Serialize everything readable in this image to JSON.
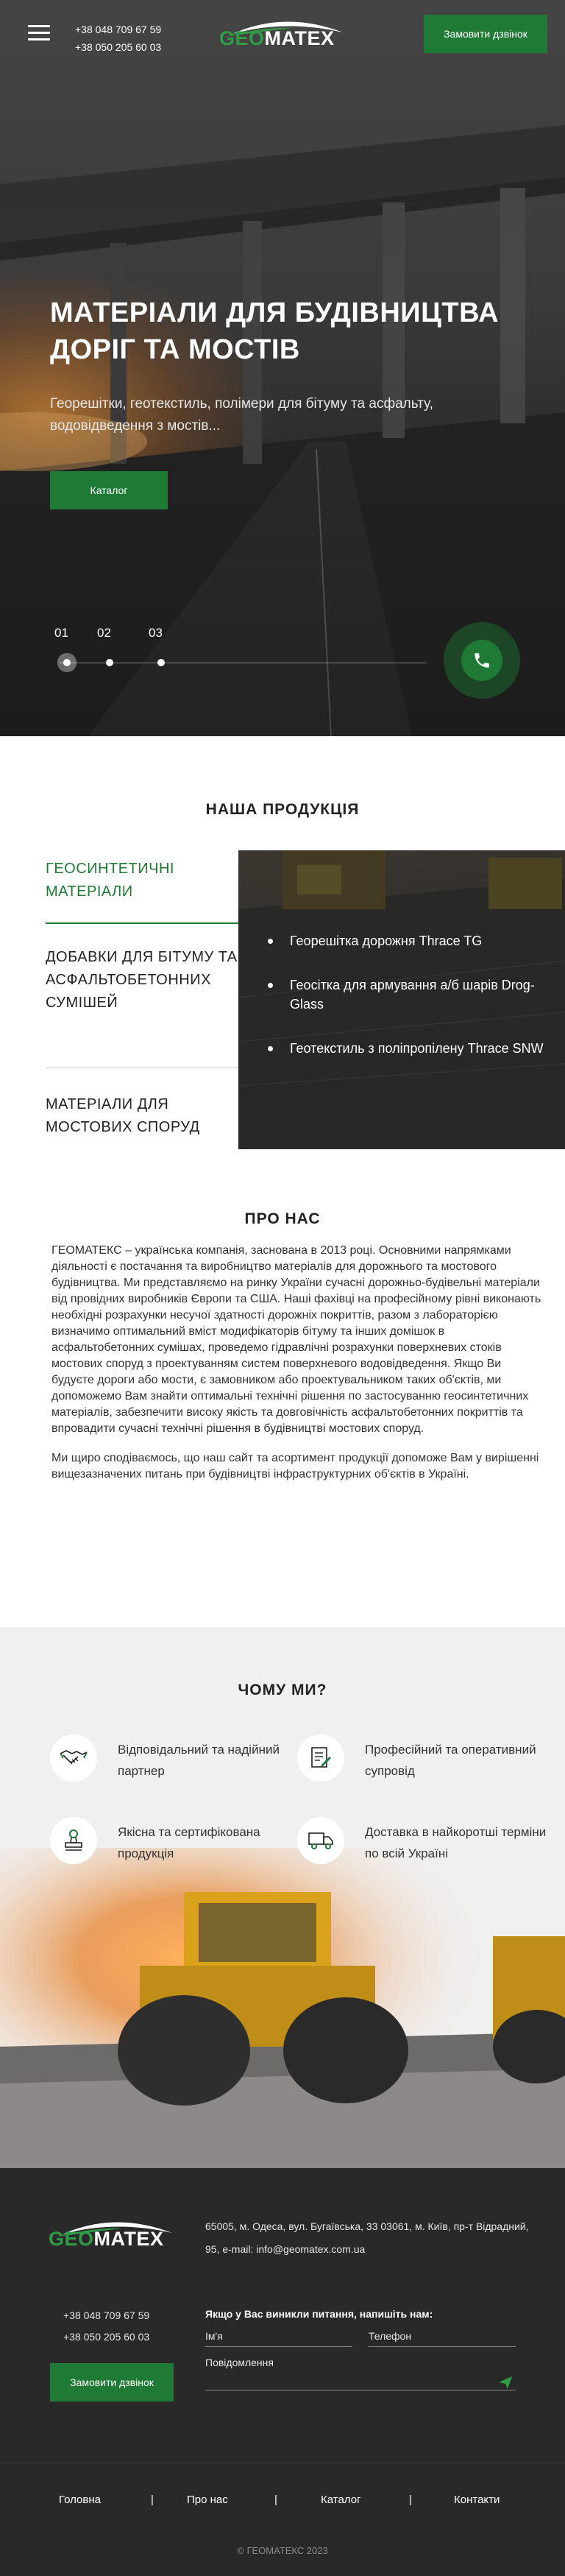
{
  "header": {
    "phone_1": "+38 048 709 67 59",
    "phone_2": "+38 050 205 60 03",
    "logo_geo": "GEO",
    "logo_matex": "MATEX",
    "call_button": "Замовити дзвінок"
  },
  "hero": {
    "title": "МАТЕРІАЛИ ДЛЯ БУДІВНИЦТВА ДОРІГ ТА МОСТІВ",
    "subtitle": "Георешітки, геотекстиль, полімери для бітуму та асфальту, водовідведення з мостів...",
    "cta": "Каталог",
    "slides": [
      "01",
      "02",
      "03"
    ],
    "active_slide": "01"
  },
  "products": {
    "title": "НАША ПРОДУКЦІЯ",
    "categories": [
      "ГЕОСИНТЕТИЧНІ МАТЕРІАЛИ",
      "ДОБАВКИ ДЛЯ БІТУМУ ТА АСФАЛЬТОБЕТОННИХ СУМІШЕЙ",
      "МАТЕРІАЛИ ДЛЯ МОСТОВИХ СПОРУД"
    ],
    "active_category": "ГЕОСИНТЕТИЧНІ МАТЕРІАЛИ",
    "items": [
      "Георешітка дорожня Thrace TG",
      "Геосітка для армування а/б шарів Drog-Glass",
      "Геотекстиль з поліпропілену Thrace SNW"
    ]
  },
  "about": {
    "title": "ПРО НАС",
    "paragraph_1": "ГЕОМАТЕКС – українська компанія, заснована в 2013 році. Основними напрямками діяльності є постачання та виробництво матеріалів для дорожнього та мостового будівництва. Ми представляємо на ринку України сучасні дорожньо-будівельні матеріали від провідних виробників Європи та США.  Наші фахівці на професійному рівні виконають необхідні розрахунки несучої здатності дорожніх покриттів, разом з лабораторією визначимо оптимальний вміст модифікаторів бітуму та інших домішок в асфальтобетонних сумішах, проведемо гідравлічні розрахунки поверхневих стоків мостових споруд з проектуванням систем поверхневого водовідведення. Якщо Ви будуєте дороги або мости, є замовником або проектувальником таких об'єктів, ми допоможемо Вам знайти оптимальні технічні рішення по застосуванню геосинтетичних матеріалів, забезпечити високу якість та довговічність асфальтобетонних покриттів та впровадити сучасні технічні рішення в будівництві мостових споруд.",
    "paragraph_2": "Ми щиро сподіваємось, що наш сайт та асортимент продукції допоможе Вам у вирішенні вищезазначених питань при будівництві інфраструктурних об'єктів в Україні."
  },
  "why": {
    "title": "ЧОМУ МИ?",
    "items": [
      {
        "label": "Відповідальний та надійний партнер",
        "icon": "handshake-icon"
      },
      {
        "label": "Професійний та оперативний супровід",
        "icon": "document-edit-icon"
      },
      {
        "label": "Якісна та сертифікована продукція",
        "icon": "stamp-icon"
      },
      {
        "label": "Доставка в найкоротші терміни по всій Україні",
        "icon": "delivery-truck-icon"
      }
    ]
  },
  "footer": {
    "address": "65005, м. Одеса, вул. Бугаївська, 33 03061, м. Київ, пр-т  Відрадний, 95, e-mail: info@geomatex.com.ua",
    "phone_1": "+38 048 709 67 59",
    "phone_2": "+38 050 205 60 03",
    "call_button": "Замовити дзвінок",
    "form_title": "Якщо у Вас виникли питання, напишіть нам:",
    "name_placeholder": "Ім'я",
    "phone_placeholder": "Телефон",
    "message_placeholder": "Повідомлення",
    "nav": [
      "Головна",
      "Про нас",
      "Каталог",
      "Контакти"
    ],
    "separator": "|",
    "copyright": "© ГЕОМАТЕКС 2023"
  },
  "colors": {
    "brand_green": "#1f7a35",
    "logo_green": "#2f9b45",
    "footer_bg": "#292929"
  }
}
